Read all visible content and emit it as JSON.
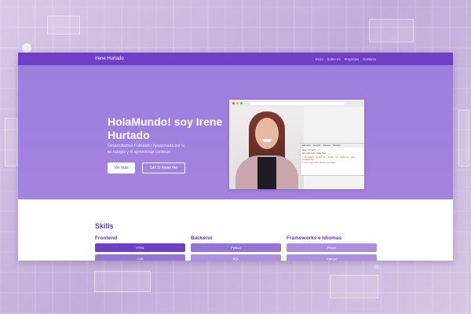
{
  "navbar": {
    "brand": "Irene Hurtado",
    "links": [
      "Inicio",
      "Sobre mí",
      "Proyectos",
      "Contacto"
    ]
  },
  "hero": {
    "title": "HolaMundo! soy Irene Hurtado",
    "subtitle": "Desarrolladora Fullstack | Apasionada por la tecnología y el aprendizaje continuo",
    "primary_button": "Ver más",
    "secondary_button": "Get to know me"
  },
  "mockup": {
    "console_tabs": [
      "Elements",
      "Console",
      "Sources",
      "Network"
    ],
    "console_lines": [
      "Open to work :)",
      "Aprendiendo cada día ...",
      "> Uncaught TypeError: Irene not found in your production",
      "> let new hire Irene.Hurtado"
    ]
  },
  "skills": {
    "title": "Skills",
    "columns": [
      {
        "heading": "Frontend",
        "items": [
          "HTML",
          "CSS"
        ]
      },
      {
        "heading": "Backend",
        "items": [
          "Python",
          "SQL"
        ]
      },
      {
        "heading": "Frameworks e Idiomas",
        "items": [
          "React",
          "Django"
        ]
      }
    ]
  },
  "colors": {
    "nav": "#6f3fc6",
    "hero": "#a07fdf",
    "accent": "#6236b4"
  }
}
